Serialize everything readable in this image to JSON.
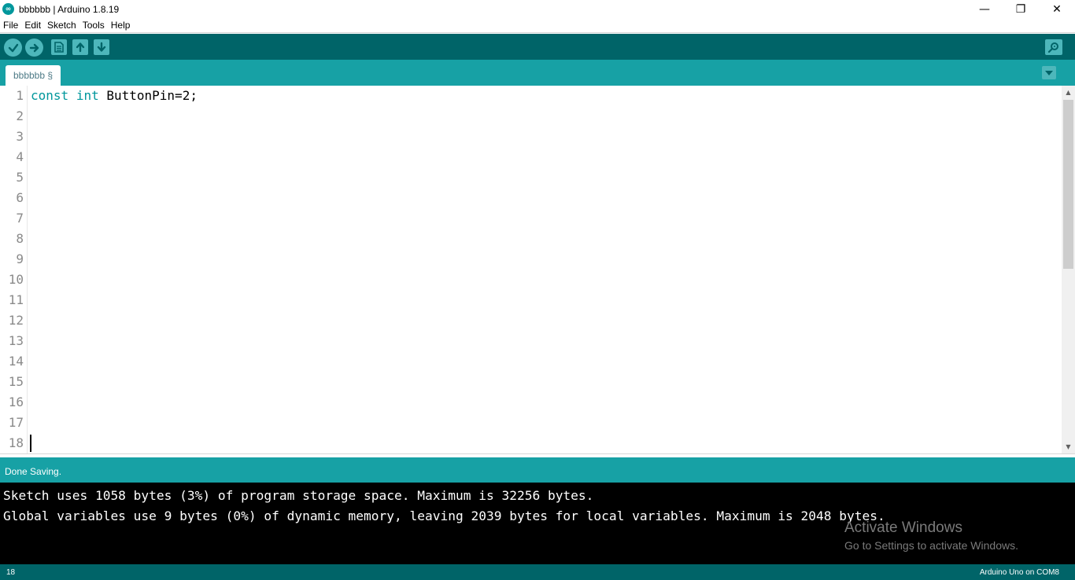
{
  "window": {
    "title": "bbbbbb | Arduino 1.8.19",
    "logo_glyph": "∞",
    "minimize": "—",
    "restore": "❐",
    "close": "✕"
  },
  "menu": [
    {
      "label": "File"
    },
    {
      "label": "Edit"
    },
    {
      "label": "Sketch"
    },
    {
      "label": "Tools"
    },
    {
      "label": "Help"
    }
  ],
  "toolbar": {
    "buttons": [
      {
        "name": "verify",
        "icon": "check-icon"
      },
      {
        "name": "upload",
        "icon": "arrow-right-icon"
      },
      {
        "name": "new",
        "icon": "new-file-icon"
      },
      {
        "name": "open",
        "icon": "arrow-up-icon"
      },
      {
        "name": "save",
        "icon": "arrow-down-icon"
      }
    ],
    "serial_monitor_icon": "magnifier-icon"
  },
  "tabs": [
    {
      "label": "bbbbbb §",
      "active": true
    }
  ],
  "editor": {
    "line_numbers": [
      "1",
      "2",
      "3",
      "4",
      "5",
      "6",
      "7",
      "8",
      "9",
      "10",
      "11",
      "12",
      "13",
      "14",
      "15",
      "16",
      "17",
      "18"
    ],
    "code_line_1": {
      "kw1": "const",
      "kw2": "int",
      "rest": "ButtonPin=2;"
    },
    "cursor_line": 18
  },
  "status": {
    "message": "Done Saving."
  },
  "console": {
    "lines": [
      "Sketch uses 1058 bytes (3%) of program storage space. Maximum is 32256 bytes.",
      "Global variables use 9 bytes (0%) of dynamic memory, leaving 2039 bytes for local variables. Maximum is 2048 bytes."
    ],
    "watermark_title": "Activate Windows",
    "watermark_sub": "Go to Settings to activate Windows."
  },
  "footer": {
    "line": "18",
    "board": "Arduino Uno on COM8"
  },
  "colors": {
    "toolbar": "#006468",
    "tabstrip": "#17a1a5",
    "button": "#4db7bb",
    "keyword": "#00979c"
  }
}
